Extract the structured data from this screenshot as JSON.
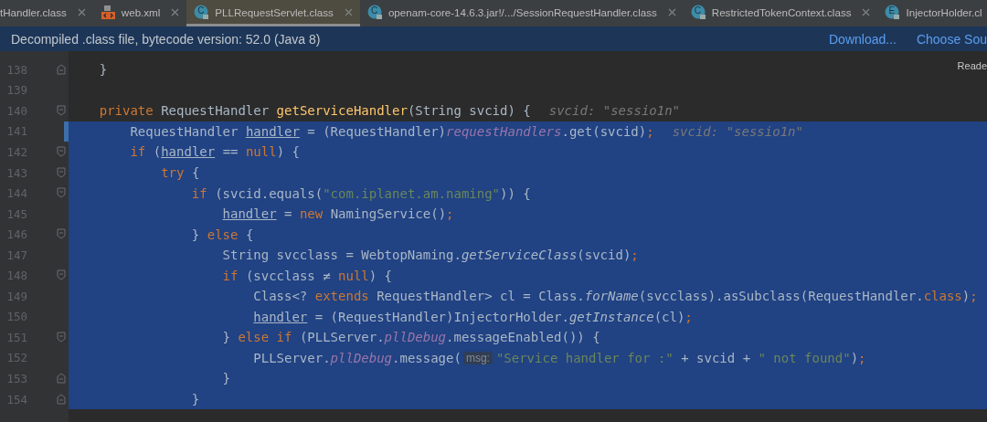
{
  "tabs": [
    {
      "label": "tHandler.class",
      "selected": false,
      "closable": true
    },
    {
      "label": "web.xml",
      "kind": "xml",
      "selected": false,
      "closable": true
    },
    {
      "label": "PLLRequestServlet.class",
      "kind": "class",
      "badge": "C",
      "selected": true,
      "closable": true
    },
    {
      "label": "openam-core-14.6.3.jar!/.../SessionRequestHandler.class",
      "kind": "class",
      "badge": "C",
      "selected": false,
      "closable": true
    },
    {
      "label": "RestrictedTokenContext.class",
      "kind": "class",
      "badge": "C",
      "selected": false,
      "closable": true
    },
    {
      "label": "InjectorHolder.cl",
      "kind": "class",
      "badge": "E",
      "selected": false,
      "closable": false
    }
  ],
  "banner": {
    "text": "Decompiled .class file, bytecode version: 52.0 (Java 8)",
    "actions": [
      "Download...",
      "Choose Sou"
    ]
  },
  "reader_mode": "Reade",
  "lines": [
    {
      "number": "138",
      "selected": false,
      "changed": false,
      "fold": {
        "kind": "end"
      },
      "tokens": [
        {
          "t": "    }",
          "kind": "id"
        }
      ]
    },
    {
      "number": "139",
      "selected": false,
      "changed": false
    },
    {
      "number": "140",
      "selected": false,
      "changed": false,
      "fold": {
        "kind": "start"
      },
      "tokens": [
        {
          "t": "    private ",
          "kind": "kw"
        },
        {
          "t": "RequestHandler ",
          "kind": "id"
        },
        {
          "t": "getServiceHandler",
          "kind": "fn"
        },
        {
          "t": "(String svcid) {",
          "kind": "id"
        },
        {
          "t": "svcid: \"sessio1n\"",
          "kind": "hint"
        }
      ]
    },
    {
      "number": "141",
      "selected": true,
      "changed": true,
      "tokens": [
        {
          "t": "        RequestHandler ",
          "kind": "id"
        },
        {
          "t": "handler",
          "kind": "var"
        },
        {
          "t": " = (RequestHandler)",
          "kind": "id"
        },
        {
          "t": "requestHandlers",
          "kind": "field"
        },
        {
          "t": ".get(svcid)",
          "kind": "id"
        },
        {
          "t": ";",
          "kind": "semi"
        },
        {
          "t": "svcid: \"sessio1n\"",
          "kind": "hint"
        }
      ]
    },
    {
      "number": "142",
      "selected": true,
      "changed": false,
      "fold": {
        "kind": "start"
      },
      "tokens": [
        {
          "t": "        if",
          "kind": "kw"
        },
        {
          "t": " (",
          "kind": "id"
        },
        {
          "t": "handler",
          "kind": "var"
        },
        {
          "t": " == ",
          "kind": "id"
        },
        {
          "t": "null",
          "kind": "kw"
        },
        {
          "t": ") {",
          "kind": "id"
        }
      ]
    },
    {
      "number": "143",
      "selected": true,
      "changed": false,
      "fold": {
        "kind": "start"
      },
      "tokens": [
        {
          "t": "            try",
          "kind": "kw"
        },
        {
          "t": " {",
          "kind": "id"
        }
      ]
    },
    {
      "number": "144",
      "selected": true,
      "changed": false,
      "fold": {
        "kind": "start"
      },
      "tokens": [
        {
          "t": "                if",
          "kind": "kw"
        },
        {
          "t": " (svcid.equals(",
          "kind": "id"
        },
        {
          "t": "\"com.iplanet.am.naming\"",
          "kind": "str"
        },
        {
          "t": ")) {",
          "kind": "id"
        }
      ]
    },
    {
      "number": "145",
      "selected": true,
      "changed": false,
      "tokens": [
        {
          "t": "                    handler",
          "kind": "var"
        },
        {
          "t": " = ",
          "kind": "id"
        },
        {
          "t": "new",
          "kind": "kw"
        },
        {
          "t": " NamingService()",
          "kind": "id"
        },
        {
          "t": ";",
          "kind": "semi"
        }
      ]
    },
    {
      "number": "146",
      "selected": true,
      "changed": false,
      "fold": {
        "kind": "start"
      },
      "tokens": [
        {
          "t": "                } ",
          "kind": "id"
        },
        {
          "t": "else",
          "kind": "kw"
        },
        {
          "t": " {",
          "kind": "id"
        }
      ]
    },
    {
      "number": "147",
      "selected": true,
      "changed": false,
      "tokens": [
        {
          "t": "                    String svcclass = WebtopNaming.",
          "kind": "id"
        },
        {
          "t": "getServiceClass",
          "kind": "static"
        },
        {
          "t": "(svcid)",
          "kind": "id"
        },
        {
          "t": ";",
          "kind": "semi"
        }
      ]
    },
    {
      "number": "148",
      "selected": true,
      "changed": false,
      "fold": {
        "kind": "start"
      },
      "tokens": [
        {
          "t": "                    if",
          "kind": "kw"
        },
        {
          "t": " (svcclass ≠ ",
          "kind": "id"
        },
        {
          "t": "null",
          "kind": "kw"
        },
        {
          "t": ") {",
          "kind": "id"
        }
      ]
    },
    {
      "number": "149",
      "selected": true,
      "changed": false,
      "tokens": [
        {
          "t": "                        Class<? ",
          "kind": "id"
        },
        {
          "t": "extends",
          "kind": "kw"
        },
        {
          "t": " RequestHandler> cl = Class.",
          "kind": "id"
        },
        {
          "t": "forName",
          "kind": "static"
        },
        {
          "t": "(svcclass).asSubclass(RequestHandler.",
          "kind": "id"
        },
        {
          "t": "class",
          "kind": "kw"
        },
        {
          "t": ")",
          "kind": "id"
        },
        {
          "t": ";",
          "kind": "semi"
        }
      ]
    },
    {
      "number": "150",
      "selected": true,
      "changed": false,
      "tokens": [
        {
          "t": "                        handler",
          "kind": "var"
        },
        {
          "t": " = (RequestHandler)InjectorHolder.",
          "kind": "id"
        },
        {
          "t": "getInstance",
          "kind": "static"
        },
        {
          "t": "(cl)",
          "kind": "id"
        },
        {
          "t": ";",
          "kind": "semi"
        }
      ]
    },
    {
      "number": "151",
      "selected": true,
      "changed": false,
      "fold": {
        "kind": "start"
      },
      "tokens": [
        {
          "t": "                    } ",
          "kind": "id"
        },
        {
          "t": "else if",
          "kind": "kw"
        },
        {
          "t": " (PLLServer.",
          "kind": "id"
        },
        {
          "t": "pllDebug",
          "kind": "field"
        },
        {
          "t": ".messageEnabled()) {",
          "kind": "id"
        }
      ]
    },
    {
      "number": "152",
      "selected": true,
      "changed": false,
      "tokens": [
        {
          "t": "                        PLLServer.",
          "kind": "id"
        },
        {
          "t": "pllDebug",
          "kind": "field"
        },
        {
          "t": ".message(",
          "kind": "id"
        },
        {
          "t": "msg:",
          "kind": "param"
        },
        {
          "t": "\"Service handler for :\"",
          "kind": "str"
        },
        {
          "t": " + svcid + ",
          "kind": "id"
        },
        {
          "t": "\" not found\"",
          "kind": "str"
        },
        {
          "t": ")",
          "kind": "id"
        },
        {
          "t": ";",
          "kind": "semi"
        }
      ]
    },
    {
      "number": "153",
      "selected": true,
      "changed": false,
      "fold": {
        "kind": "end"
      },
      "tokens": [
        {
          "t": "                    }",
          "kind": "id"
        }
      ]
    },
    {
      "number": "154",
      "selected": true,
      "changed": false,
      "fold": {
        "kind": "end"
      },
      "tokens": [
        {
          "t": "                }",
          "kind": "id"
        }
      ]
    }
  ]
}
